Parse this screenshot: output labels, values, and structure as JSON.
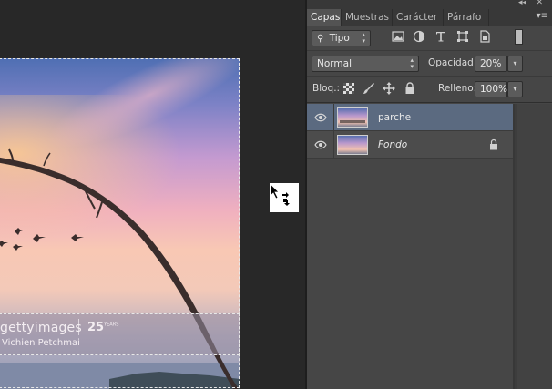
{
  "canvas": {
    "watermark": {
      "brand": "gettyimages",
      "anniversary": "25",
      "anniversary_sup": "YEARS",
      "author": "Vichien Petchmai"
    }
  },
  "panel": {
    "tabs": [
      {
        "label": "Capas",
        "active": true
      },
      {
        "label": "Muestras",
        "active": false
      },
      {
        "label": "Carácter",
        "active": false
      },
      {
        "label": "Párrafo",
        "active": false
      }
    ],
    "filter": {
      "kind_label": "Tipo",
      "icons": [
        "image-filter-icon",
        "adjustment-filter-icon",
        "type-filter-icon",
        "shape-filter-icon",
        "smart-object-filter-icon"
      ]
    },
    "blend_mode": "Normal",
    "opacity_label": "Opacidad:",
    "opacity_value": "20%",
    "lock_label": "Bloq.:",
    "lock_icons": [
      "lock-transparent-pixels-icon",
      "lock-image-pixels-icon",
      "lock-position-icon",
      "lock-all-icon"
    ],
    "fill_label": "Relleno:",
    "fill_value": "100%",
    "layers": [
      {
        "name": "parche",
        "selected": true,
        "visible": true,
        "locked": false,
        "italic": false
      },
      {
        "name": "Fondo",
        "selected": false,
        "visible": true,
        "locked": true,
        "italic": true
      }
    ]
  },
  "colors": {
    "panel_bg": "#464646",
    "tab_active": "#535353",
    "selected_layer": "#5b6a80",
    "canvas_bg": "#282828"
  }
}
